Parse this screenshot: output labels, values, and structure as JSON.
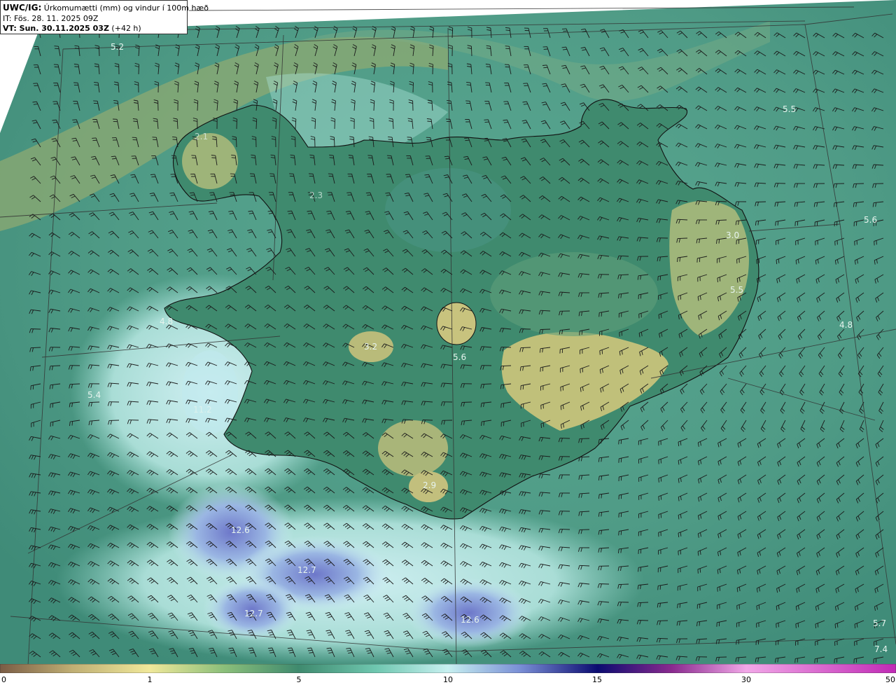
{
  "header": {
    "model_label": "UWC/IG:",
    "title": "Úrkomumætti (mm) og vindur í 100m hæð",
    "init_time": "IT: Fös. 28. 11. 2025 09Z",
    "valid_label": "VT: Sun. 30.11.2025 03Z",
    "valid_offset": " (+42 h)"
  },
  "values": {
    "v1": "5.2",
    "v2": "5.5",
    "v3": "5.6",
    "v4": "3.0",
    "v5": "5.5",
    "v6": "4.8",
    "v7": "4.8",
    "v8": "3.2",
    "v9": "5.6",
    "v10": "5.4",
    "v11": "2.9",
    "v12": "12.6",
    "v13": "12.7",
    "v14": "12.7",
    "v15": "12.6",
    "v16": "5.7",
    "v17": "7.4",
    "v18": "2.1",
    "v19": "2.3",
    "v20": "11.2"
  },
  "colorbar": {
    "ticks": [
      "0",
      "1",
      "5",
      "10",
      "15",
      "30",
      "50"
    ],
    "colors": [
      "#7a5c45",
      "#d9c67a",
      "#f0e89a",
      "#8bbf7a",
      "#3f8a6e",
      "#6fc7b0",
      "#b9ecec",
      "#cfeff7",
      "#7a8fd6",
      "#1a1f9e",
      "#0b0b60",
      "#8a2a8f",
      "#f2a8e8",
      "#c02ab5"
    ]
  }
}
